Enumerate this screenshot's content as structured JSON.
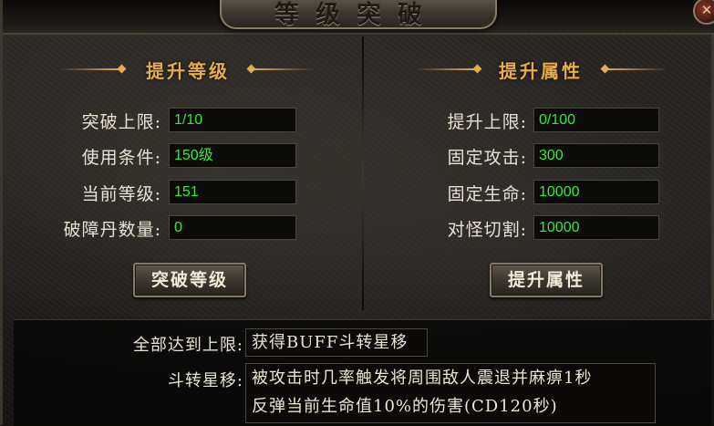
{
  "window": {
    "title": "等级突破",
    "close_glyph": "✕"
  },
  "left_panel": {
    "heading": "提升等级",
    "rows": [
      {
        "label": "突破上限:",
        "value": "1/10"
      },
      {
        "label": "使用条件:",
        "value": "150级"
      },
      {
        "label": "当前等级:",
        "value": "151"
      },
      {
        "label": "破障丹数量:",
        "value": "0"
      }
    ],
    "button_label": "突破等级"
  },
  "right_panel": {
    "heading": "提升属性",
    "rows": [
      {
        "label": "提升上限:",
        "value": "0/100"
      },
      {
        "label": "固定攻击:",
        "value": "300"
      },
      {
        "label": "固定生命:",
        "value": "10000"
      },
      {
        "label": "对怪切割:",
        "value": "10000"
      }
    ],
    "button_label": "提升属性"
  },
  "bottom": {
    "reward_label": "全部达到上限:",
    "reward_value": "获得BUFF斗转星移",
    "buff_label": "斗转星移:",
    "buff_line1": "被攻击时几率触发将周围敌人震退并麻痹1秒",
    "buff_line2": "反弹当前生命值10%的伤害(CD120秒)"
  },
  "colors": {
    "heading": "#e6ac4a",
    "value_text": "#2ef02e",
    "label_text": "#e9e2d4"
  }
}
